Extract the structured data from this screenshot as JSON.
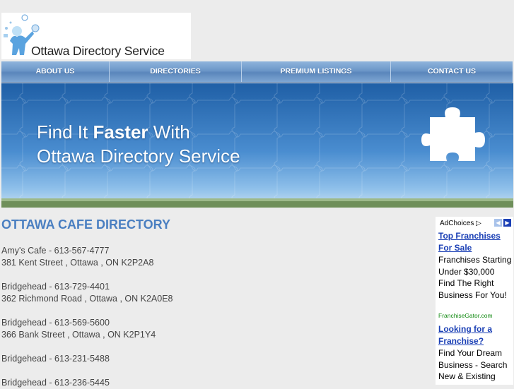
{
  "logo": {
    "text": "Ottawa Directory Service"
  },
  "nav": {
    "items": [
      {
        "label": "ABOUT US"
      },
      {
        "label": "DIRECTORIES"
      },
      {
        "label": "PREMIUM LISTINGS"
      },
      {
        "label": "CONTACT US"
      }
    ]
  },
  "hero": {
    "line1_prefix": "Find It",
    "line1_bold": "Faster",
    "line1_suffix": "With",
    "line2": "Ottawa Directory Service"
  },
  "main": {
    "title": "OTTAWA CAFE DIRECTORY",
    "entries": [
      {
        "line1": "Amy's Cafe - 613-567-4777",
        "line2": "381 Kent Street , Ottawa , ON K2P2A8"
      },
      {
        "line1": "Bridgehead - 613-729-4401",
        "line2": "362 Richmond Road , Ottawa , ON K2A0E8"
      },
      {
        "line1": "Bridgehead - 613-569-5600",
        "line2": "366 Bank Street , Ottawa , ON K2P1Y4"
      },
      {
        "line1": "Bridgehead - 613-231-5488",
        "line2": ""
      },
      {
        "line1": "Bridgehead - 613-236-5445",
        "line2": ""
      }
    ]
  },
  "ad": {
    "adchoices": "AdChoices",
    "ad1_title": "Top Franchises For Sale",
    "ad1_text": "Franchises Starting Under $30,000 Find The Right Business For You!",
    "ad1_url": "FranchiseGator.com",
    "ad2_title": "Looking for a Franchise?",
    "ad2_text": "Find Your Dream Business - Search New & Existing"
  },
  "colors": {
    "accent": "#4a7fc1",
    "nav": "#6c97c8",
    "ad_link": "#1a3fb5",
    "ad_url": "#118a11"
  }
}
